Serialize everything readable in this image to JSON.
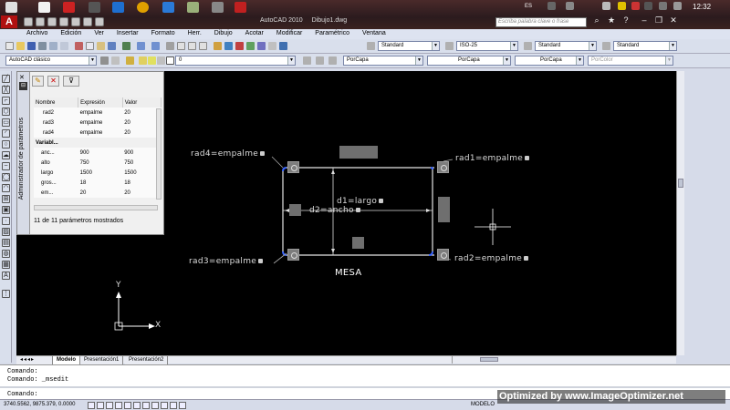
{
  "titlebar": {
    "app_name": "AutoCAD 2010",
    "file_name": "Dibujo1.dwg",
    "search_placeholder": "Escriba palabra clave o frase",
    "clock": "12:32",
    "lang": "ES",
    "logo": "A"
  },
  "menu": [
    "Archivo",
    "Edición",
    "Ver",
    "Insertar",
    "Formato",
    "Herr.",
    "Dibujo",
    "Acotar",
    "Modificar",
    "Paramétrico",
    "Ventana"
  ],
  "toolbar": {
    "text_style": "Standard",
    "dim_style": "ISO-25",
    "table_style": "Standard",
    "mleader_style": "Standard",
    "workspace": "AutoCAD clásico",
    "layer": "0",
    "color": "PorCapa",
    "linetype": "PorCapa",
    "lineweight": "PorCapa",
    "plotstyle": "PorColor"
  },
  "palette": {
    "title": "Administrador de parámetros",
    "headers": [
      "Nombre",
      "Expresión",
      "Valor"
    ],
    "rows_top": [
      {
        "name": "rad2",
        "expr": "empalme",
        "value": "20"
      },
      {
        "name": "rad3",
        "expr": "empalme",
        "value": "20"
      },
      {
        "name": "rad4",
        "expr": "empalme",
        "value": "20"
      }
    ],
    "group_label": "Variabl...",
    "rows_vars": [
      {
        "name": "anc...",
        "expr": "900",
        "value": "900"
      },
      {
        "name": "alto",
        "expr": "750",
        "value": "750"
      },
      {
        "name": "largo",
        "expr": "1500",
        "value": "1500"
      },
      {
        "name": "gros...",
        "expr": "18",
        "value": "18"
      },
      {
        "name": "em...",
        "expr": "20",
        "value": "20"
      }
    ],
    "status": "11 de 11 parámetros mostrados"
  },
  "drawing": {
    "rad4": "rad4=empalme",
    "rad1": "rad1=empalme",
    "rad3": "rad3=empalme",
    "rad2": "rad2=empalme",
    "d1": "d1=largo",
    "d2": "d2=ancho",
    "caption": "MESA",
    "ucs_x": "X",
    "ucs_y": "Y"
  },
  "tabs": [
    "Modelo",
    "Presentación1",
    "Presentación2"
  ],
  "command": {
    "line1": "Comando:",
    "line2": "Comando: _msedit",
    "prompt": "Comando:"
  },
  "status": {
    "coords": "3740.5562, 9875.379, 0.0000",
    "mode": "MODELO"
  },
  "watermark": "Optimized by www.ImageOptimizer.net"
}
